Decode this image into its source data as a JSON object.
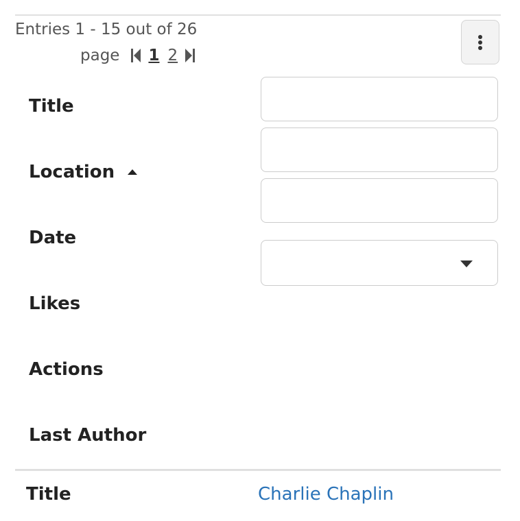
{
  "summary": {
    "text": "Entries 1 - 15 out of 26"
  },
  "pager": {
    "label": "page",
    "first_icon": "first-page-icon",
    "last_icon": "last-page-icon",
    "pages": [
      "1",
      "2"
    ],
    "current": "1"
  },
  "menu_button": {
    "icon": "vertical-ellipsis-icon"
  },
  "fields": {
    "title": "Title",
    "location": "Location",
    "date": "Date",
    "likes": "Likes",
    "actions": "Actions",
    "last_author": "Last Author"
  },
  "sort": {
    "icon": "sort-ascending-icon"
  },
  "filters": {
    "title_value": "",
    "location_value": "",
    "date_value": "",
    "likes_select_value": ""
  },
  "first_row": {
    "label": "Title",
    "value": "Charlie Chaplin"
  },
  "colors": {
    "link": "#2a73b8",
    "border": "#cccccc",
    "divider": "#e0e0e0"
  }
}
